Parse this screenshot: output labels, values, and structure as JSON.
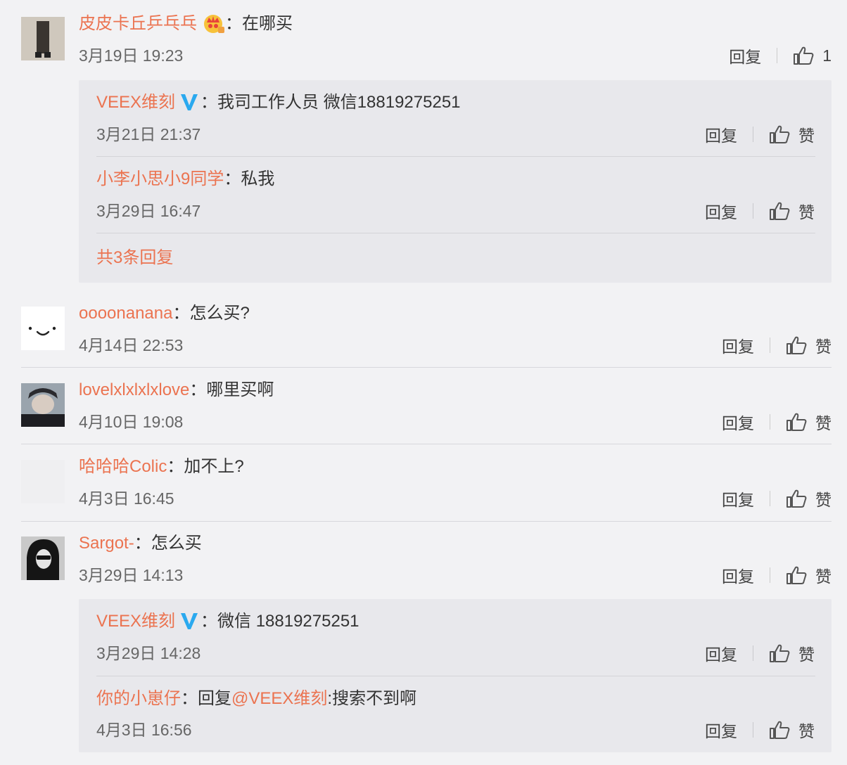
{
  "colors": {
    "username": "#eb7350",
    "text": "#333333",
    "meta": "#666666",
    "reply_bg": "#e8e8ec",
    "page_bg": "#f2f2f4",
    "verified": "#2aa9ef"
  },
  "labels": {
    "reply": "回复",
    "like": "赞",
    "colon": "："
  },
  "comments": [
    {
      "user": "皮皮卡丘乒乓乓",
      "badge": "crown-icon",
      "text": "在哪买",
      "time": "3月19日 19:23",
      "likes": "1",
      "replies": [
        {
          "user": "VEEX维刻",
          "verified": true,
          "text": "我司工作人员 微信18819275251",
          "time": "3月21日 21:37"
        },
        {
          "user": "小李小思小9同学",
          "text": "私我",
          "time": "3月29日 16:47"
        }
      ],
      "more": "共3条回复"
    },
    {
      "user": "oooonanana",
      "text": "怎么买?",
      "time": "4月14日 22:53"
    },
    {
      "user": "lovelxlxlxlxlove",
      "text": "哪里买啊",
      "time": "4月10日 19:08"
    },
    {
      "user": "哈哈哈Colic",
      "text": "加不上?",
      "time": "4月3日 16:45"
    },
    {
      "user": "Sargot-",
      "text": "怎么买",
      "time": "3月29日 14:13",
      "replies": [
        {
          "user": "VEEX维刻",
          "verified": true,
          "text": "微信 18819275251",
          "time": "3月29日 14:28"
        },
        {
          "user": "你的小崽仔",
          "text_prefix": "回复",
          "mention": "@VEEX维刻",
          "text": ":搜索不到啊",
          "time": "4月3日 16:56"
        }
      ]
    }
  ]
}
